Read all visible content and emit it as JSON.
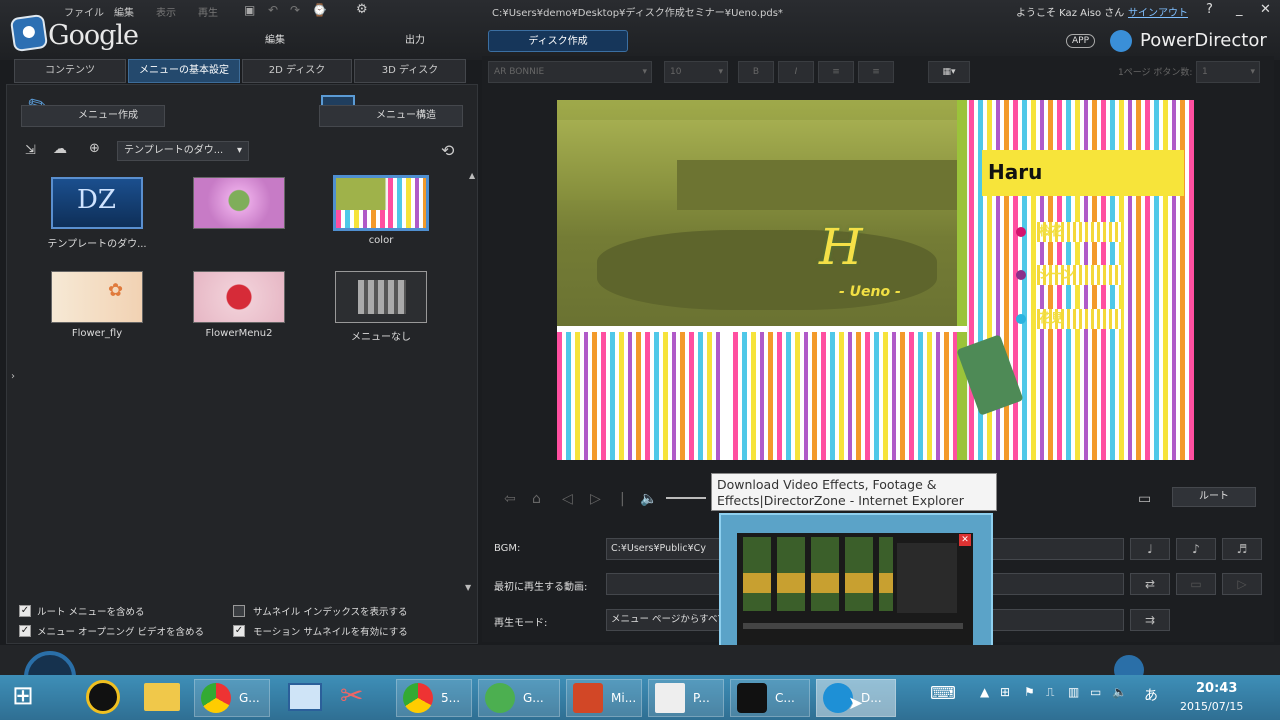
{
  "app": {
    "menu": [
      "ファイル",
      "編集",
      "表示",
      "再生"
    ],
    "file_path": "C:¥Users¥demo¥Desktop¥ディスク作成セミナー¥Ueno.pds*",
    "welcome": "ようこそ Kaz Aiso さん",
    "signout": "サインアウト",
    "logo_text": "Google",
    "brand": "PowerDirector",
    "app_badge": "APP",
    "top_tabs": [
      "編集",
      "出力",
      "ディスク作成"
    ],
    "help": "?"
  },
  "sub_tabs": [
    "コンテンツ",
    "メニューの基本設定",
    "2D ディスク",
    "3D ディスク"
  ],
  "left": {
    "menu_create": "メニュー作成",
    "menu_structure": "メニュー構造",
    "template_dropdown": "テンプレートのダウ...",
    "templates": [
      {
        "label": "テンプレートのダウ...",
        "kind": "dz"
      },
      {
        "label": "",
        "kind": "flower"
      },
      {
        "label": "color",
        "kind": "color"
      },
      {
        "label": "Flower_fly",
        "kind": "flowerfly"
      },
      {
        "label": "FlowerMenu2",
        "kind": "flowermenu"
      },
      {
        "label": "メニューなし",
        "kind": "none"
      }
    ],
    "checkboxes": [
      {
        "label": "ルート メニューを含める",
        "checked": true
      },
      {
        "label": "サムネイル インデックスを表示する",
        "checked": false
      },
      {
        "label": "メニュー オープニング ビデオを含める",
        "checked": true
      },
      {
        "label": "モーション サムネイルを有効にする",
        "checked": true
      }
    ]
  },
  "toolbar": {
    "font": "AR BONNIE",
    "size": "10",
    "per_page_label": "1ページ ボタン数:",
    "per_page_value": "1"
  },
  "preview": {
    "title": "Haru",
    "script": "H",
    "ueno": "- Ueno -",
    "items": [
      "桜花",
      "シーン",
      "花見"
    ],
    "root_button": "ルート"
  },
  "tooltip": "Download Video Effects, Footage & Effects|DirectorZone - Internet Explorer",
  "properties": {
    "bgm_label": "BGM:",
    "bgm_value": "C:¥Users¥Public¥Cy",
    "first_play_label": "最初に再生する動画:",
    "play_mode_label": "再生モード:",
    "play_mode_value": "メニュー ページからすべて"
  },
  "taskbar": {
    "apps": [
      {
        "label": "G...",
        "name": "chrome-1"
      },
      {
        "label": "",
        "name": "remote"
      },
      {
        "label": "",
        "name": "snipping"
      },
      {
        "label": "5...",
        "name": "chrome-2"
      },
      {
        "label": "G...",
        "name": "app-green"
      },
      {
        "label": "Mi...",
        "name": "powerpoint"
      },
      {
        "label": "P...",
        "name": "pdf"
      },
      {
        "label": "C...",
        "name": "camera"
      },
      {
        "label": "D...",
        "name": "ie"
      }
    ],
    "time": "20:43",
    "date": "2015/07/15",
    "ime": "あ"
  },
  "colors": {
    "accent": "#24496d",
    "taskbar": "#3e8fb8",
    "haru_yellow": "#f7e43a"
  }
}
